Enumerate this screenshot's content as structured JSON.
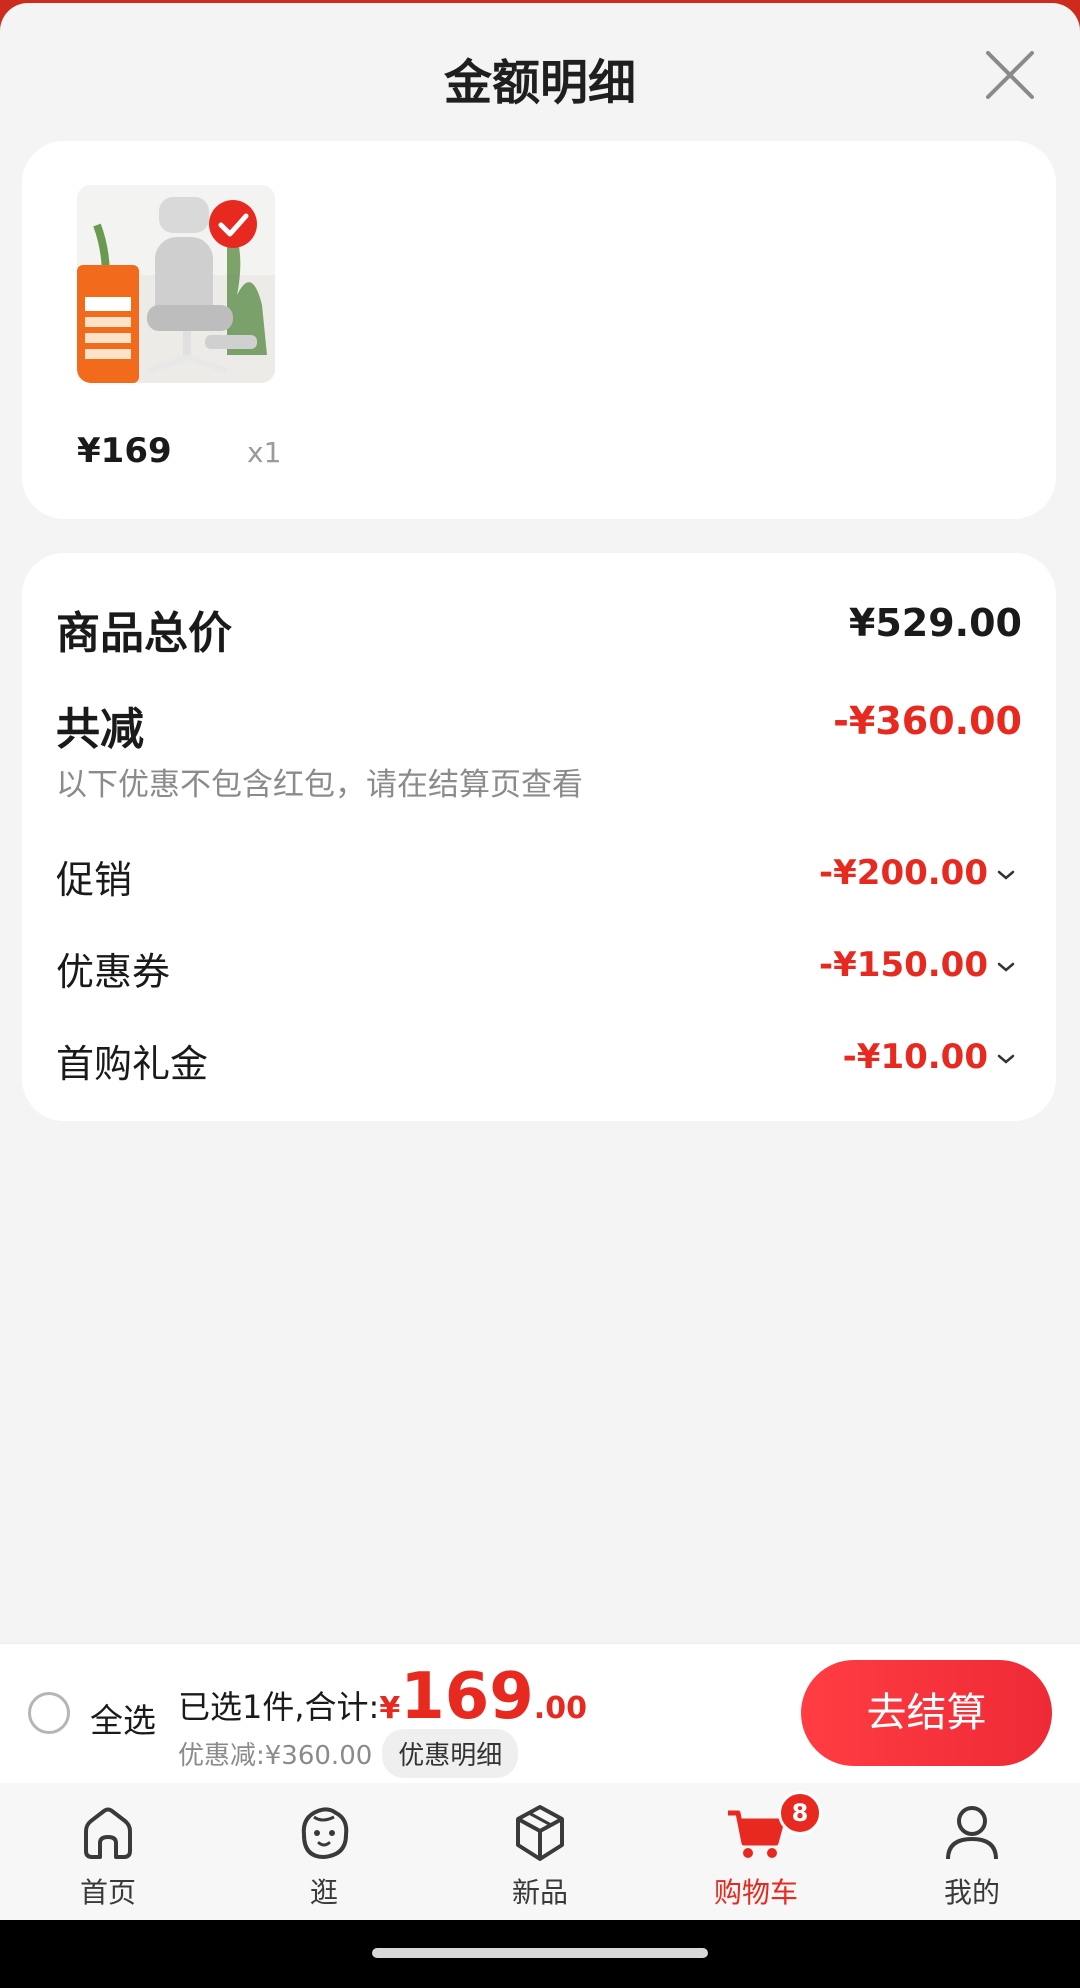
{
  "sheet": {
    "title": "金额明细"
  },
  "product": {
    "price": "¥169",
    "qty": "x1"
  },
  "summary": {
    "total_label": "商品总价",
    "total_value": "¥529.00",
    "reduce_label": "共减",
    "reduce_value": "-¥360.00",
    "note": "以下优惠不包含红包，请在结算页查看",
    "discounts": [
      {
        "label": "促销",
        "value": "-¥200.00"
      },
      {
        "label": "优惠券",
        "value": "-¥150.00"
      },
      {
        "label": "首购礼金",
        "value": "-¥10.00"
      }
    ]
  },
  "checkout": {
    "select_all": "全选",
    "selected_text": "已选1件,合计:",
    "currency": "¥",
    "total_int": "169",
    "total_dec": ".00",
    "discount_text": "优惠减:¥360.00",
    "detail_label": "优惠明细",
    "button_label": "去结算"
  },
  "tabbar": {
    "tabs": [
      {
        "label": "首页",
        "icon": "home-icon"
      },
      {
        "label": "逛",
        "icon": "browse-face-icon"
      },
      {
        "label": "新品",
        "icon": "cube-icon"
      },
      {
        "label": "购物车",
        "icon": "cart-icon",
        "active": true,
        "badge": "8"
      },
      {
        "label": "我的",
        "icon": "user-icon"
      }
    ]
  },
  "colors": {
    "accent": "#e8291f",
    "background": "#f4f4f4",
    "card": "#ffffff"
  }
}
